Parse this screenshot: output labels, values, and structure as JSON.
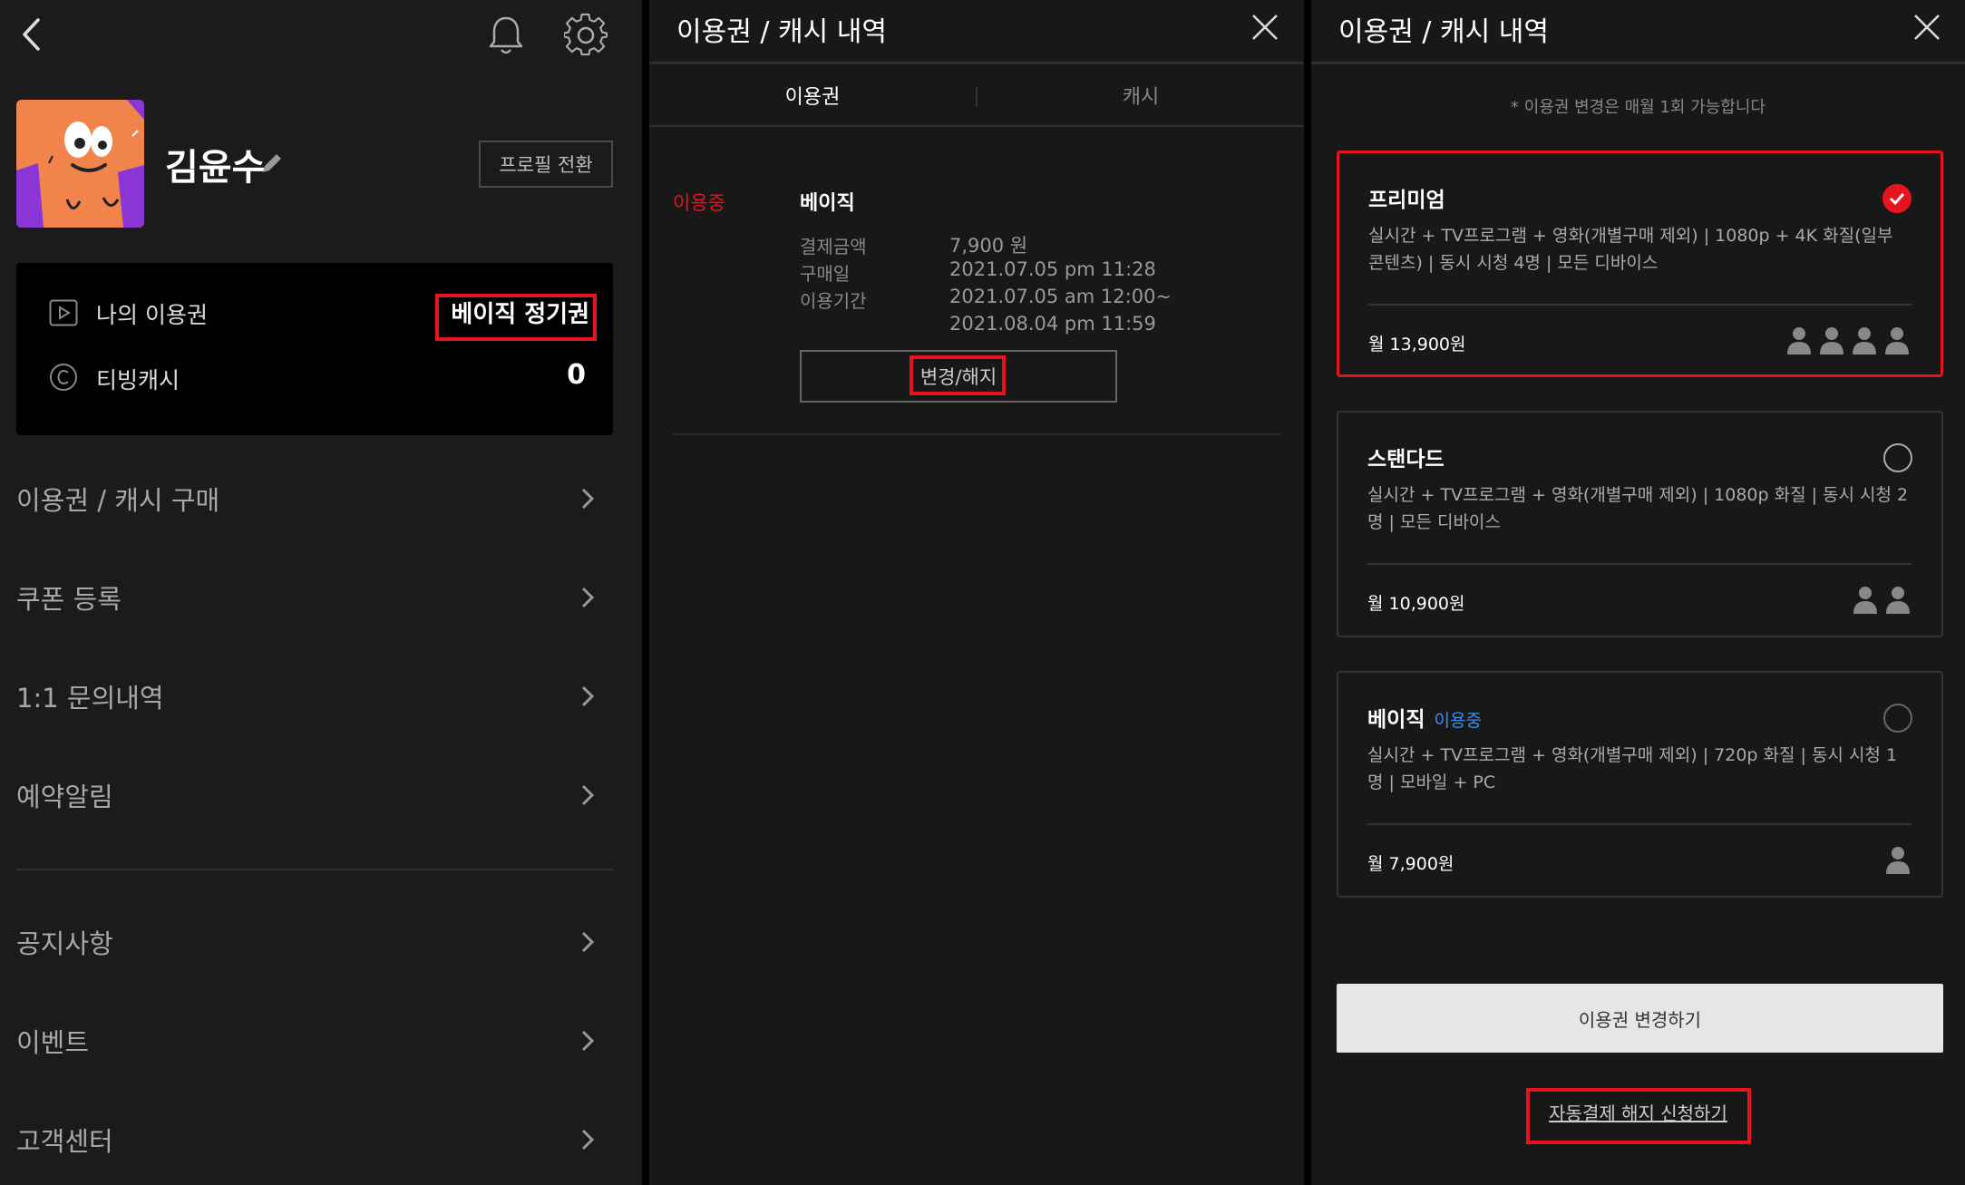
{
  "profile_panel": {
    "username": "김윤수",
    "switch_profile_label": "프로필 전환",
    "my_ticket_label": "나의 이용권",
    "my_ticket_value": "베이직 정기권",
    "cash_label": "티빙캐시",
    "cash_value": "0",
    "menu": [
      {
        "label": "이용권 / 캐시 구매"
      },
      {
        "label": "쿠폰 등록"
      },
      {
        "label": "1:1 문의내역"
      },
      {
        "label": "예약알림"
      },
      {
        "label": "공지사항"
      },
      {
        "label": "이벤트"
      },
      {
        "label": "고객센터"
      }
    ]
  },
  "history_panel": {
    "title": "이용권 / 캐시 내역",
    "tabs": [
      "이용권",
      "캐시"
    ],
    "status": "이용중",
    "plan_name": "베이직",
    "fields": [
      {
        "key": "결제금액",
        "value": "7,900 원"
      },
      {
        "key": "구매일",
        "value": "2021.07.05 pm 11:28"
      },
      {
        "key": "이용기간",
        "value": "2021.07.05 am 12:00~"
      },
      {
        "key": "",
        "value": "2021.08.04 pm 11:59"
      }
    ],
    "change_button": "변경/해지"
  },
  "plans_panel": {
    "title": "이용권 / 캐시 내역",
    "note": "* 이용권 변경은 매월 1회 가능합니다",
    "plans": [
      {
        "name": "프리미엄",
        "badge": "",
        "desc": "실시간 + TV프로그램 + 영화(개별구매 제외) | 1080p + 4K 화질(일부 콘텐츠) | 동시 시청 4명 | 모든 디바이스",
        "price": "월 13,900원",
        "selected": true,
        "users": 4
      },
      {
        "name": "스탠다드",
        "badge": "",
        "desc": "실시간 + TV프로그램 + 영화(개별구매 제외) | 1080p 화질 | 동시 시청 2명 | 모든 디바이스",
        "price": "월 10,900원",
        "selected": false,
        "users": 2
      },
      {
        "name": "베이직",
        "badge": "이용중",
        "desc": "실시간 + TV프로그램 + 영화(개별구매 제외) | 720p 화질 | 동시 시청 1명 | 모바일 + PC",
        "price": "월 7,900원",
        "selected": false,
        "users": 1
      }
    ],
    "change_plan_button": "이용권 변경하기",
    "cancel_autopay_link": "자동결제 해지 신청하기"
  },
  "colors": {
    "accent_red": "#e6141e",
    "badge_blue": "#3a8ff0",
    "panel_bg": "#1b1b1b"
  }
}
